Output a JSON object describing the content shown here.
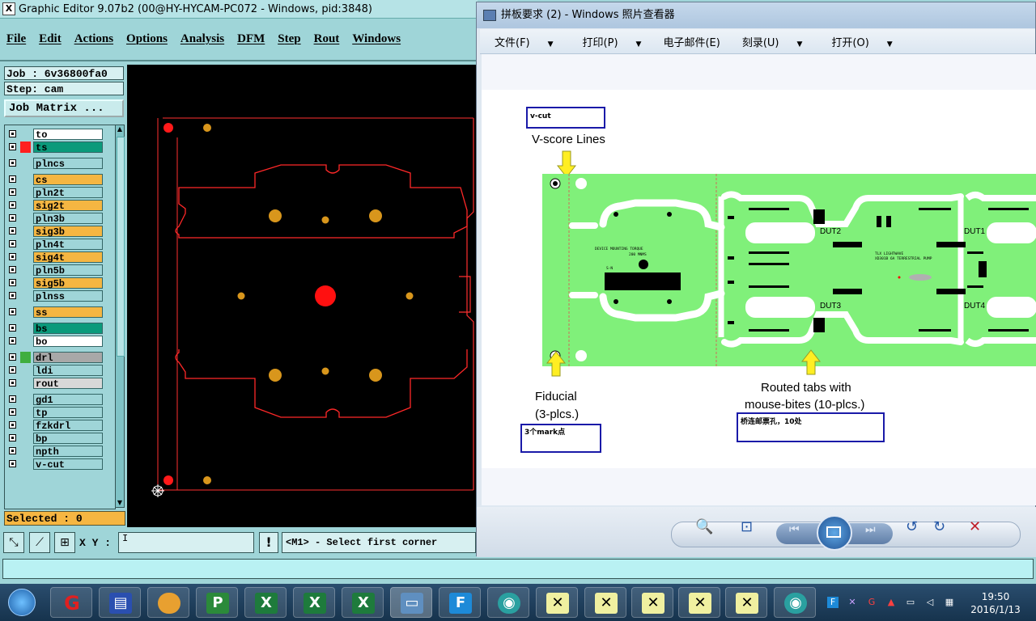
{
  "editor": {
    "title": "Graphic Editor 9.07b2 (00@HY-HYCAM-PC072 - Windows, pid:3848)",
    "menu": [
      "File",
      "Edit",
      "Actions",
      "Options",
      "Analysis",
      "DFM",
      "Step",
      "Rout",
      "Windows"
    ],
    "job": "Job : 6v36800fa0",
    "step": "Step: cam",
    "job_matrix": "Job Matrix ...",
    "layers": [
      {
        "name": "to",
        "color": "#ffffff",
        "mark": ""
      },
      {
        "name": "ts",
        "color": "#0b9a7b",
        "mark": "#ff2020"
      },
      {
        "name": "plncs",
        "color": "#9fd5d8",
        "mark": ""
      },
      {
        "name": "cs",
        "color": "#f5b642",
        "mark": ""
      },
      {
        "name": "pln2t",
        "color": "#9fd5d8",
        "mark": ""
      },
      {
        "name": "sig2t",
        "color": "#f5b642",
        "mark": ""
      },
      {
        "name": "pln3b",
        "color": "#9fd5d8",
        "mark": ""
      },
      {
        "name": "sig3b",
        "color": "#f5b642",
        "mark": ""
      },
      {
        "name": "pln4t",
        "color": "#9fd5d8",
        "mark": ""
      },
      {
        "name": "sig4t",
        "color": "#f5b642",
        "mark": ""
      },
      {
        "name": "pln5b",
        "color": "#9fd5d8",
        "mark": ""
      },
      {
        "name": "sig5b",
        "color": "#f5b642",
        "mark": ""
      },
      {
        "name": "plnss",
        "color": "#9fd5d8",
        "mark": ""
      },
      {
        "name": "ss",
        "color": "#f5b642",
        "mark": ""
      },
      {
        "name": "bs",
        "color": "#0b9a7b",
        "mark": ""
      },
      {
        "name": "bo",
        "color": "#ffffff",
        "mark": ""
      },
      {
        "name": "drl",
        "color": "#a8a8a8",
        "mark": "#3fae3f"
      },
      {
        "name": "ldi",
        "color": "#9fd5d8",
        "mark": ""
      },
      {
        "name": "rout",
        "color": "#d8d8d8",
        "mark": ""
      },
      {
        "name": "gd1",
        "color": "#9fd5d8",
        "mark": ""
      },
      {
        "name": "tp",
        "color": "#9fd5d8",
        "mark": ""
      },
      {
        "name": "fzkdrl",
        "color": "#9fd5d8",
        "mark": ""
      },
      {
        "name": "bp",
        "color": "#9fd5d8",
        "mark": ""
      },
      {
        "name": "npth",
        "color": "#9fd5d8",
        "mark": ""
      },
      {
        "name": "v-cut",
        "color": "#9fd5d8",
        "mark": ""
      }
    ],
    "selected": "Selected : 0",
    "xy_label": "X Y :",
    "xy_value": "I",
    "prompt_button": "!",
    "prompt": "<M1> - Select first corner"
  },
  "viewer": {
    "title": "拼板要求 (2) - Windows 照片查看器",
    "menu": [
      "文件(F)",
      "打印(P)",
      "电子邮件(E)",
      "刻录(U)",
      "打开(O)"
    ],
    "image": {
      "vcut_box": "v-cut",
      "vscore_label": "V-score Lines",
      "fiducial_label": "Fiducial",
      "fiducial_count": "(3-plcs.)",
      "mark_box": "3个mark点",
      "routed_label": "Routed tabs with",
      "routed_label2": "mouse-bites (10-plcs.)",
      "tab_box": "桥连邮票孔，10处",
      "dut_labels": [
        "DUT2",
        "DUT1",
        "DUT3",
        "DUT4"
      ],
      "board_text_1": "DEVICE MOUNTING TORQUE",
      "board_text_2": "200 MNMS",
      "sn": "S-N",
      "board_text_3": "TLX LIGHTWAVE",
      "board_text_4": "XD301B 6A TERRESTRIAL PUMP"
    }
  },
  "taskbar": {
    "time": "19:50",
    "date": "2016/1/13"
  },
  "colors": {
    "board_green": "#80f07a",
    "route_red": "#ff2424",
    "pad_orange": "#d8961c"
  }
}
